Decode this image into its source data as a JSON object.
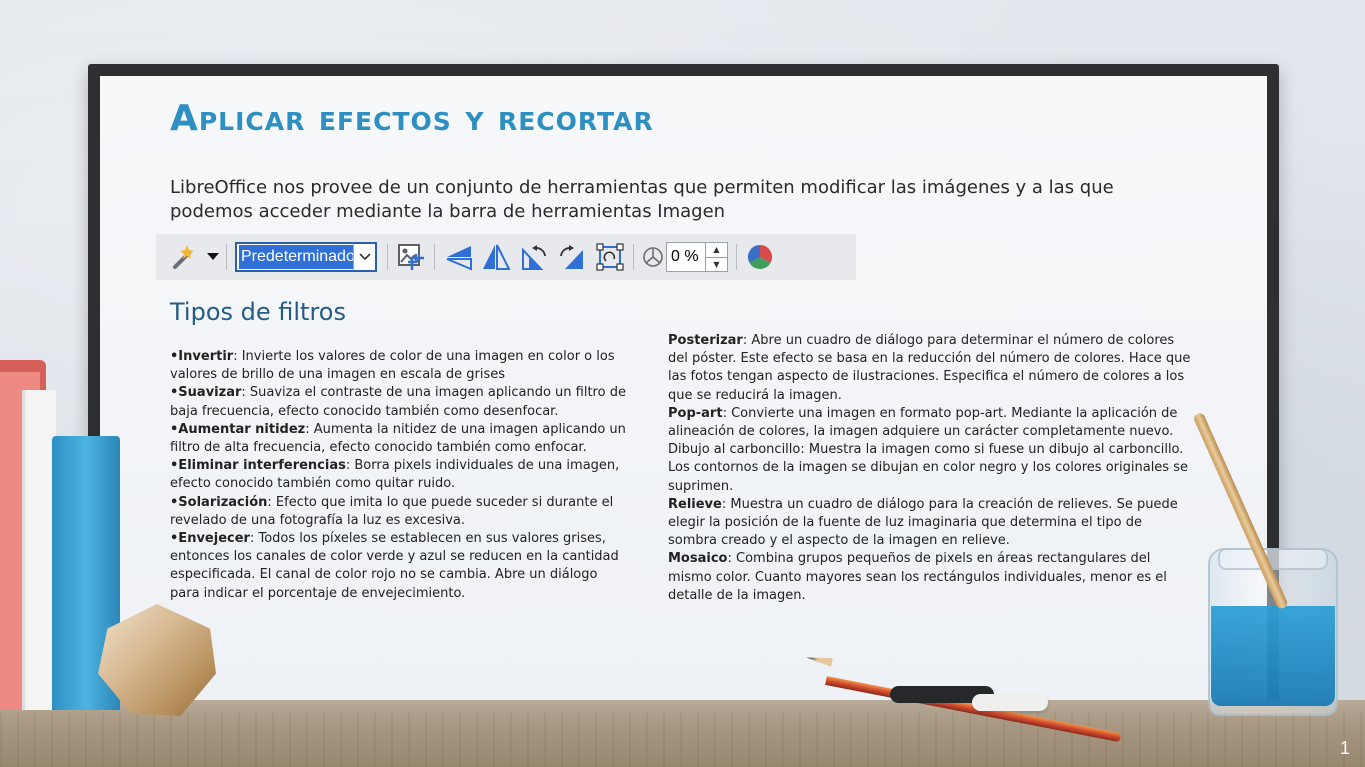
{
  "slide": {
    "title": "Aplicar efectos y recortar",
    "intro": "LibreOffice nos provee de un conjunto de herramientas que permiten modificar las imágenes y a las que podemos acceder mediante la barra de herramientas Imagen",
    "subtitle": "Tipos de filtros",
    "page_number": "1"
  },
  "toolbar": {
    "filter_icon": "magic-wand-icon",
    "mode_select_value": "Predeterminado",
    "transparency_value": "0 %",
    "icons": [
      "crop-icon",
      "flip-vertical-icon",
      "flip-horizontal-icon",
      "rotate-left-icon",
      "rotate-right-icon",
      "rotate-icon",
      "transparency-icon",
      "color-icon"
    ]
  },
  "filters_left": [
    {
      "name": "•Invertir",
      "desc": ": Invierte los valores de color de una imagen en color o los valores de brillo de una imagen en escala de grises"
    },
    {
      "name": "•Suavizar",
      "desc": ": Suaviza el contraste de una imagen aplicando un filtro de baja frecuencia, efecto conocido también como desenfocar."
    },
    {
      "name": "•Aumentar nitidez",
      "desc": ": Aumenta la nitidez de una imagen aplicando un filtro de alta frecuencia, efecto conocido también como enfocar."
    },
    {
      "name": "•Eliminar interferencias",
      "desc": ": Borra pixels individuales de una imagen, efecto conocido también como quitar ruido."
    },
    {
      "name": "•Solarización",
      "desc": ": Efecto que imita lo que puede suceder si durante el revelado de una fotografía la luz es excesiva."
    },
    {
      "name": "•Envejecer",
      "desc": ": Todos los píxeles se establecen en sus valores grises, entonces los canales de color verde y azul se reducen en la cantidad especificada. El canal de color rojo no se cambia. Abre un diálogo para indicar el porcentaje de envejecimiento."
    }
  ],
  "filters_right": [
    {
      "name": "Posterizar",
      "desc": ": Abre un cuadro de diálogo para determinar el número de colores del póster. Este efecto se basa en la reducción del número de colores. Hace que las fotos tengan aspecto de ilustraciones. Especifica el número de colores a los que se reducirá la imagen."
    },
    {
      "name": "Pop-art",
      "desc": ": Convierte una imagen en formato pop-art. Mediante la aplicación de alineación de colores, la imagen adquiere un carácter completamente nuevo."
    },
    {
      "name": "",
      "desc": "Dibujo al carboncillo: Muestra la imagen como si fuese un dibujo al carboncillo. Los contornos de la imagen se dibujan en color negro y los colores originales se suprimen."
    },
    {
      "name": "Relieve",
      "desc": ": Muestra un cuadro de diálogo para la creación de relieves. Se puede elegir la posición de la fuente de luz imaginaria que determina el tipo de sombra creado y el aspecto de la imagen en relieve."
    },
    {
      "name": "Mosaico",
      "desc": ": Combina grupos pequeños de pixels en áreas rectangulares del mismo color. Cuanto mayores sean los rectángulos individuales, menor es el detalle de la imagen."
    }
  ],
  "colors": {
    "title": "#2d8fc2",
    "subtitle": "#235d86",
    "board": "#f3f5f8",
    "frame": "#2d2f31"
  }
}
